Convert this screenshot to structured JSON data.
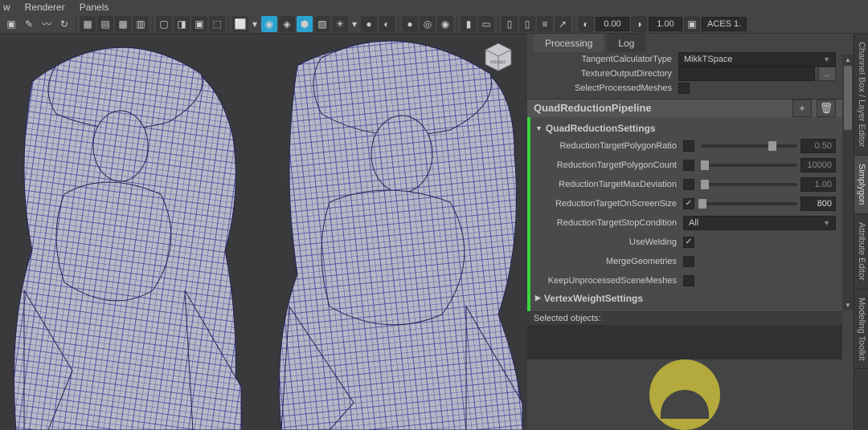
{
  "menubar": [
    "w",
    "Renderer",
    "Panels"
  ],
  "toolbar": {
    "num1": "0.00",
    "num2": "1.00",
    "color_mgmt": "ACES 1."
  },
  "panel": {
    "tabs": [
      "Processing",
      "Log"
    ],
    "active_tab": 0,
    "tangent": {
      "label": "TangentCalculatorType",
      "value": "MikkTSpace"
    },
    "texture_dir": {
      "label": "TextureOutputDirectory",
      "value": "",
      "browse": "..."
    },
    "select_processed": {
      "label": "SelectProcessedMeshes",
      "checked": false
    },
    "pipeline_title": "QuadReductionPipeline",
    "pipeline_add_icon": "+",
    "pipeline_del_icon": "🗑",
    "sections": {
      "settings_title": "QuadReductionSettings",
      "items": [
        {
          "label": "ReductionTargetPolygonRatio",
          "checked": false,
          "val": "0.50",
          "thumb": 74,
          "active": false
        },
        {
          "label": "ReductionTargetPolygonCount",
          "checked": false,
          "val": "10000",
          "thumb": 4,
          "active": false
        },
        {
          "label": "ReductionTargetMaxDeviation",
          "checked": false,
          "val": "1.00",
          "thumb": 4,
          "active": false
        },
        {
          "label": "ReductionTargetOnScreenSize",
          "checked": true,
          "val": "800",
          "thumb": 2,
          "active": true
        }
      ],
      "stop_condition": {
        "label": "ReductionTargetStopCondition",
        "value": "All"
      },
      "use_welding": {
        "label": "UseWelding",
        "checked": true
      },
      "merge_geom": {
        "label": "MergeGeometries",
        "checked": false
      },
      "keep_unproc": {
        "label": "KeepUnprocessedSceneMeshes",
        "checked": false
      },
      "vertex_weight_title": "VertexWeightSettings"
    },
    "selected_objects_label": "Selected objects:"
  },
  "side_tabs": [
    "Channel Box / Layer Editor",
    "Simplygon",
    "Attribute Editor",
    "Modeling Toolkit"
  ],
  "side_active": 1,
  "viewport": {
    "cube_label": "FRONT"
  }
}
